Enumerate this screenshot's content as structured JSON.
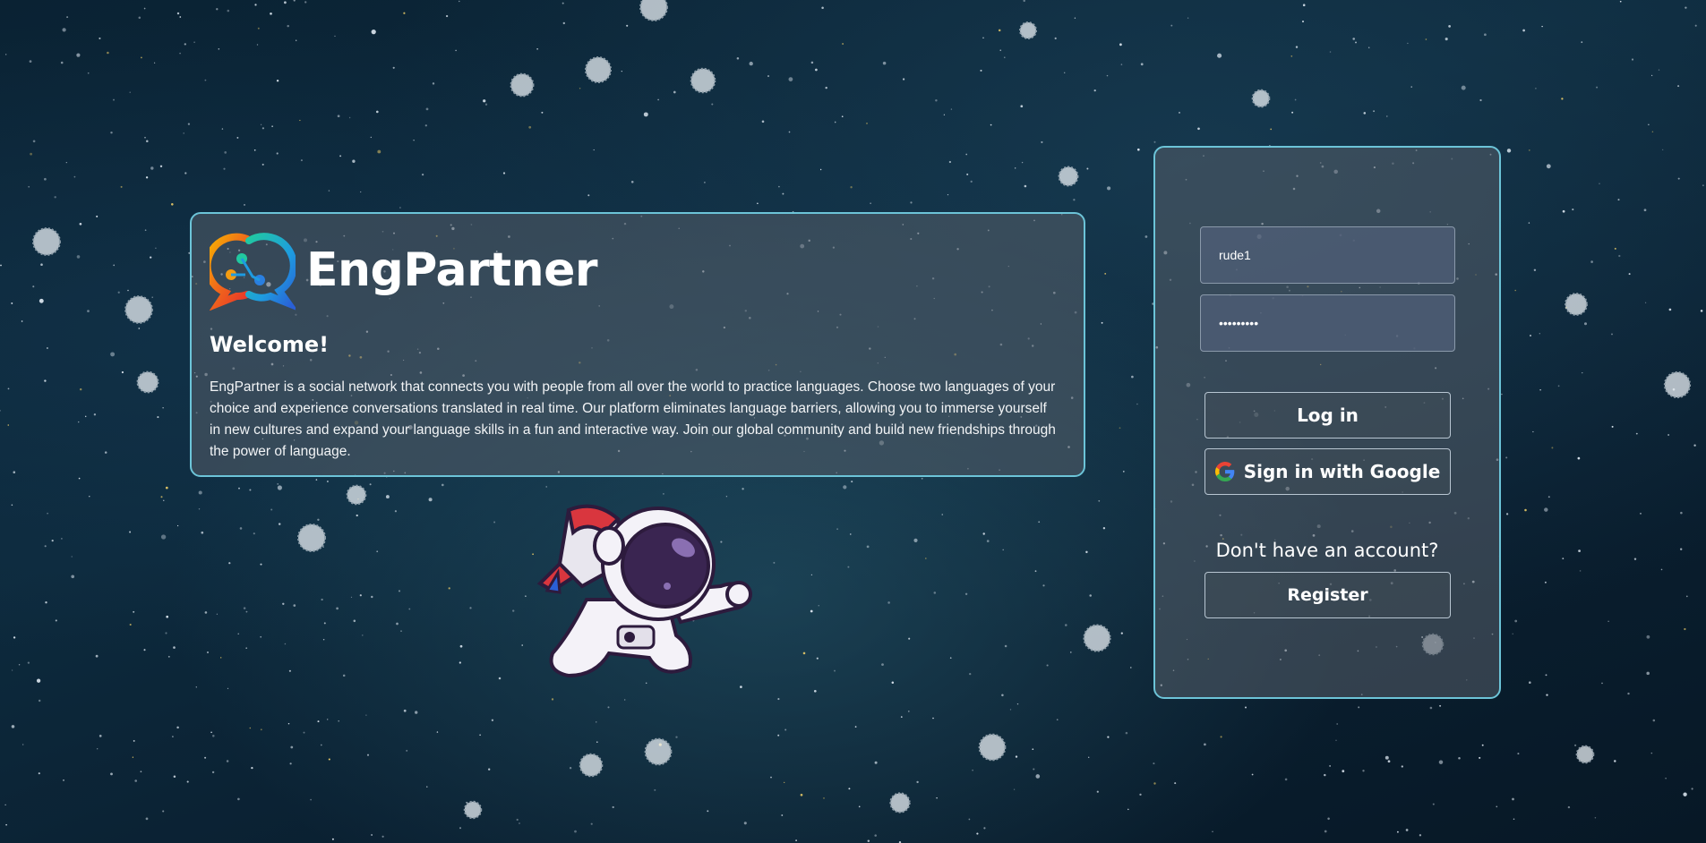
{
  "brand": {
    "name": "EngPartner",
    "logo_icon": "chat-bubbles-icon"
  },
  "welcome": {
    "title": "Welcome!",
    "text": "EngPartner is a social network that connects you with people from all over the world to practice languages. Choose two languages of your choice and experience conversations translated in real time. Our platform eliminates language barriers, allowing you to immerse yourself in new cultures and expand your language skills in a fun and interactive way. Join our global community and build new friendships through the power of language."
  },
  "login": {
    "username_value": "rude1",
    "password_value": "•••••••••",
    "login_label": "Log in",
    "google_label": "Sign in with Google",
    "no_account_text": "Don't have an account?",
    "register_label": "Register"
  },
  "colors": {
    "card_border": "#6cc4d8",
    "background": "#0d2a3d"
  },
  "icons": {
    "google": "google-icon",
    "illustration": "astronaut-illustration"
  }
}
